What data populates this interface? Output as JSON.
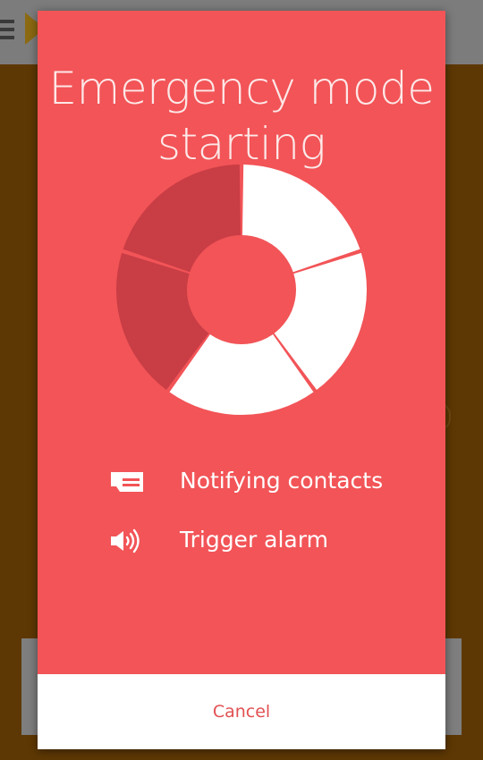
{
  "colors": {
    "backdrop": "#5e3804",
    "dialog_background": "#f25457",
    "segment_done": "#ffffff",
    "segment_pending": "#c93d45",
    "footer_background": "#ffffff",
    "cancel_text": "#e25052"
  },
  "dialog": {
    "title_line1": "Emergency mode",
    "title_line2": "starting",
    "progress": {
      "segments_total": 5,
      "segments_completed": 3
    },
    "status_items": [
      {
        "icon": "message-icon",
        "label": "Notifying contacts"
      },
      {
        "icon": "speaker-icon",
        "label": "Trigger alarm"
      }
    ],
    "cancel_label": "Cancel"
  }
}
